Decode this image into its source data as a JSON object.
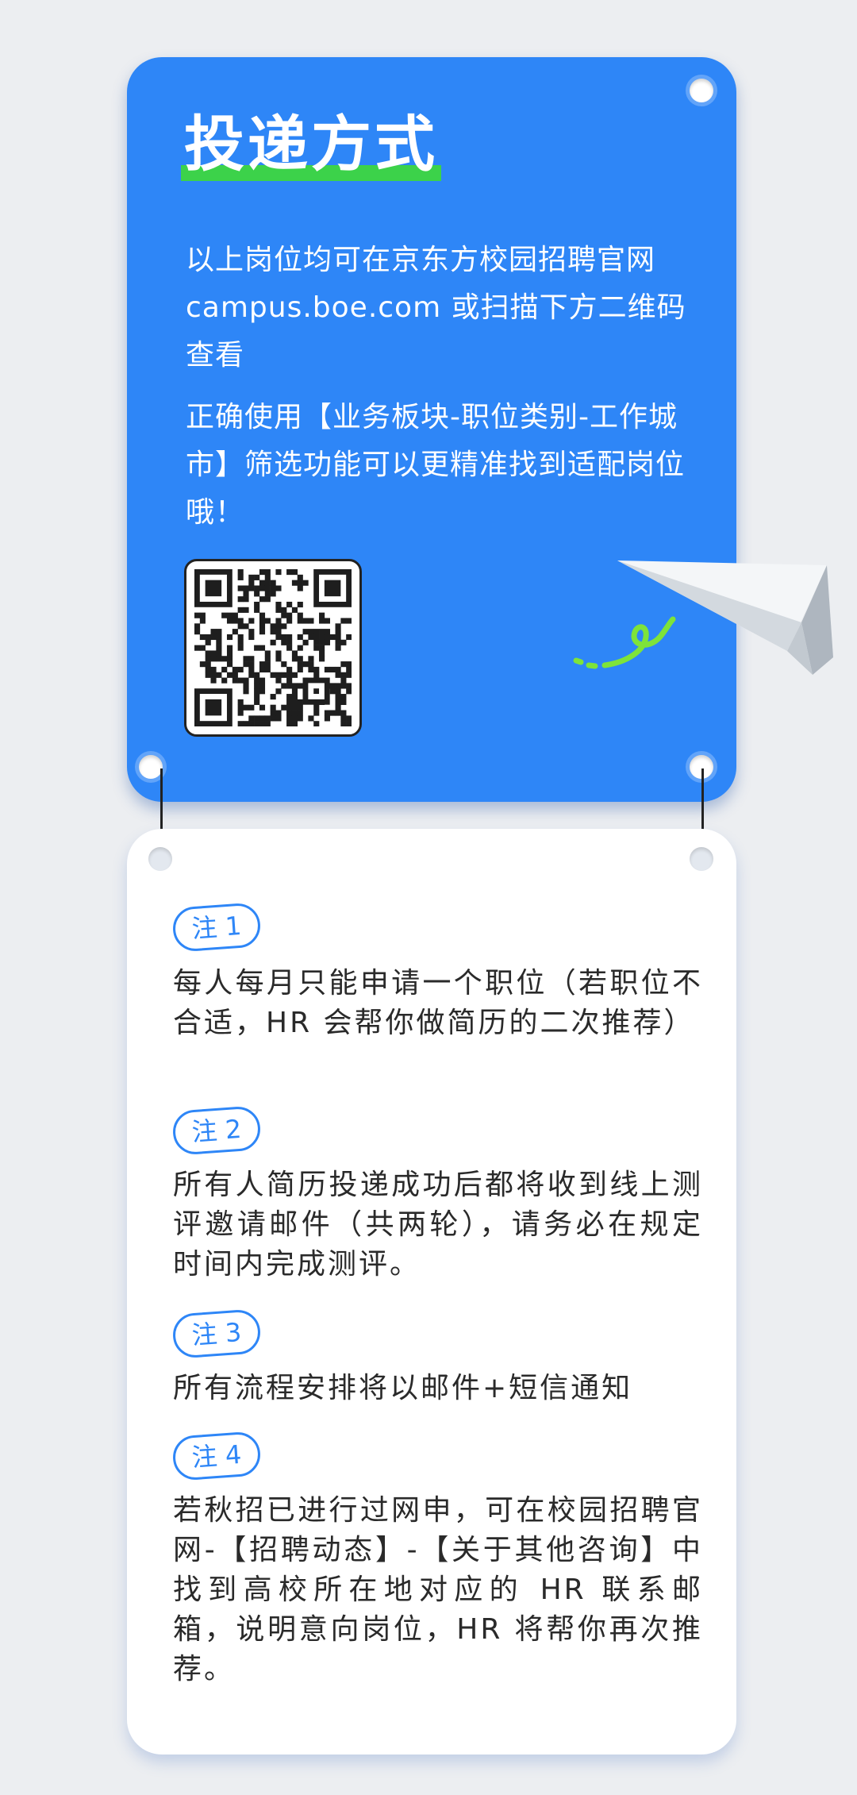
{
  "card": {
    "title": "投递方式",
    "para1": "以上岗位均可在京东方校园招聘官网campus.boe.com 或扫描下方二维码查看",
    "para2": "正确使用【业务板块-职位类别-工作城市】筛选功能可以更精准找到适配岗位哦！"
  },
  "notes": [
    {
      "tag": "注 1",
      "text": "每人每月只能申请一个职位（若职位不合适，HR 会帮你做简历的二次推荐）"
    },
    {
      "tag": "注 2",
      "text": "所有人简历投递成功后都将收到线上测评邀请邮件（共两轮），请务必在规定时间内完成测评。"
    },
    {
      "tag": "注 3",
      "text": "所有流程安排将以邮件+短信通知"
    },
    {
      "tag": "注 4",
      "text": "若秋招已进行过网申，可在校园招聘官网-【招聘动态】-【关于其他咨询】中找到高校所在地对应的 HR 联系邮箱，说明意向岗位，HR 将帮你再次推荐。"
    }
  ],
  "icons": {
    "qr": "qr-code-icon",
    "plane": "paper-plane-icon",
    "swirl": "swirl-decoration-icon"
  },
  "colors": {
    "primary_blue": "#2e86f7",
    "highlight_green": "#3cd24a",
    "swirl_green": "#7ee33a",
    "background": "#eceef1"
  }
}
